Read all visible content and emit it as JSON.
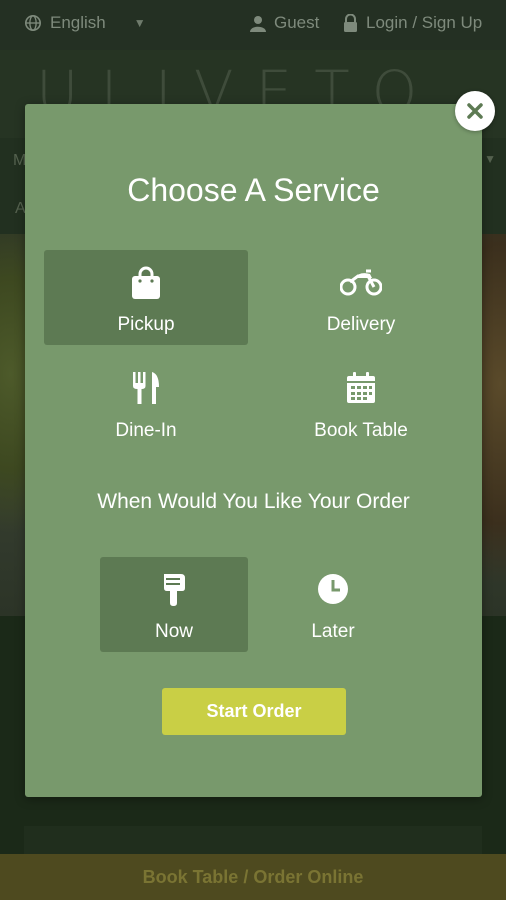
{
  "topbar": {
    "language": "English",
    "guest": "Guest",
    "login": "Login / Sign Up"
  },
  "header": {
    "logo_text": "ULIVETO"
  },
  "nav": {
    "item1": "M",
    "item2": "A",
    "caret": "▼"
  },
  "bottom_bar": {
    "label": "Book Table / Order Online"
  },
  "modal": {
    "title": "Choose A Service",
    "services": [
      {
        "label": "Pickup",
        "icon": "shopping-bag-icon",
        "selected": true
      },
      {
        "label": "Delivery",
        "icon": "motorcycle-icon",
        "selected": false
      },
      {
        "label": "Dine-In",
        "icon": "utensils-icon",
        "selected": false
      },
      {
        "label": "Book Table",
        "icon": "calendar-icon",
        "selected": false
      }
    ],
    "timing_title": "When Would You Like Your Order",
    "timing": [
      {
        "label": "Now",
        "icon": "hand-pointing-down-icon",
        "selected": true
      },
      {
        "label": "Later",
        "icon": "clock-icon",
        "selected": false
      }
    ],
    "start_button": "Start Order",
    "close_icon": "close-icon"
  },
  "colors": {
    "modal_bg": "#78996c",
    "selected_bg": "#5d7a53",
    "start_button_bg": "#c9cf45",
    "close_icon_color": "#5d7a53"
  }
}
